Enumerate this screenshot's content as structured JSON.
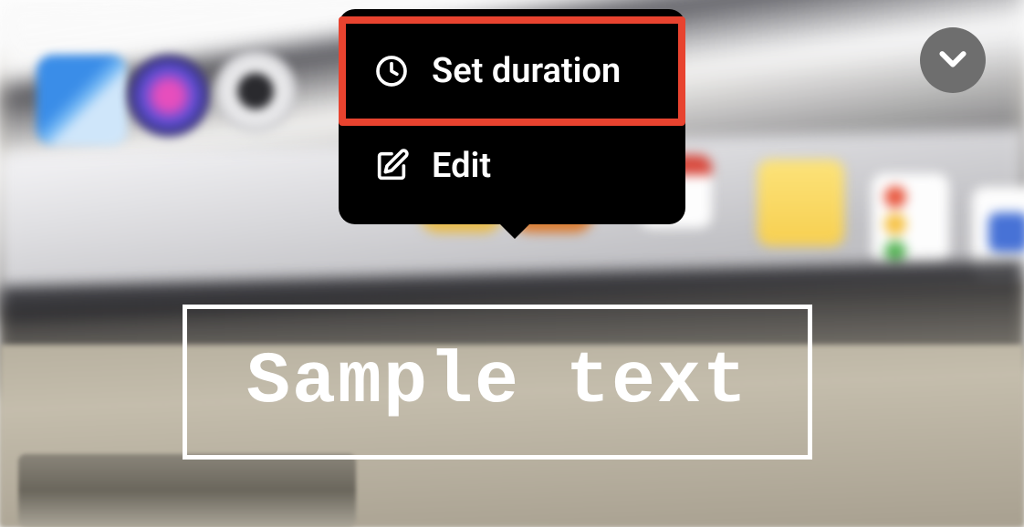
{
  "popup": {
    "items": [
      {
        "label": "Set duration",
        "icon": "clock-icon",
        "highlighted": true
      },
      {
        "label": "Edit",
        "icon": "edit-icon",
        "highlighted": false
      }
    ]
  },
  "text_overlay": {
    "content": "Sample text"
  },
  "collapse_button": {
    "icon": "chevron-down-icon"
  },
  "colors": {
    "highlight": "#e8432f",
    "popup_bg": "#000000",
    "button_bg": "#6e6e6e",
    "text": "#ffffff"
  }
}
